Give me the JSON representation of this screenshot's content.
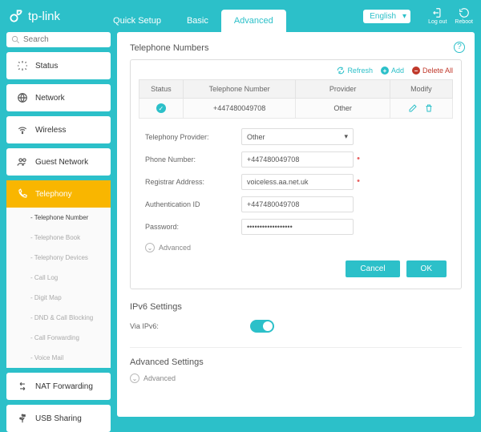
{
  "brand": "tp-link",
  "tabs": {
    "quick": "Quick Setup",
    "basic": "Basic",
    "advanced": "Advanced"
  },
  "top": {
    "lang": "English",
    "logout": "Log out",
    "reboot": "Reboot"
  },
  "search": {
    "placeholder": "Search"
  },
  "nav": {
    "status": "Status",
    "network": "Network",
    "wireless": "Wireless",
    "guest": "Guest Network",
    "telephony": "Telephony",
    "nat": "NAT Forwarding",
    "usb": "USB Sharing"
  },
  "sub": {
    "tel_num": "- Telephone Number",
    "tel_book": "- Telephone Book",
    "tel_dev": "- Telephony Devices",
    "call_log": "- Call Log",
    "digit_map": "- Digit Map",
    "dnd": "- DND & Call Blocking",
    "fwd": "- Call Forwarding",
    "vm": "- Voice Mail"
  },
  "section1_title": "Telephone Numbers",
  "toolbar": {
    "refresh": "Refresh",
    "add": "Add",
    "delete": "Delete All"
  },
  "table": {
    "h_status": "Status",
    "h_num": "Telephone Number",
    "h_provider": "Provider",
    "h_modify": "Modify",
    "row": {
      "num": "+447480049708",
      "provider": "Other"
    }
  },
  "form": {
    "provider_label": "Telephony Provider:",
    "provider_value": "Other",
    "phone_label": "Phone Number:",
    "phone_value": "+447480049708",
    "reg_label": "Registrar Address:",
    "reg_value": "voiceless.aa.net.uk",
    "auth_label": "Authentication ID",
    "auth_value": "+447480049708",
    "pass_label": "Password:",
    "pass_value": "••••••••••••••••••",
    "advanced": "Advanced",
    "cancel": "Cancel",
    "ok": "OK"
  },
  "section2_title": "IPv6 Settings",
  "ipv6_label": "Via IPv6:",
  "section3_title": "Advanced Settings",
  "adv2": "Advanced"
}
